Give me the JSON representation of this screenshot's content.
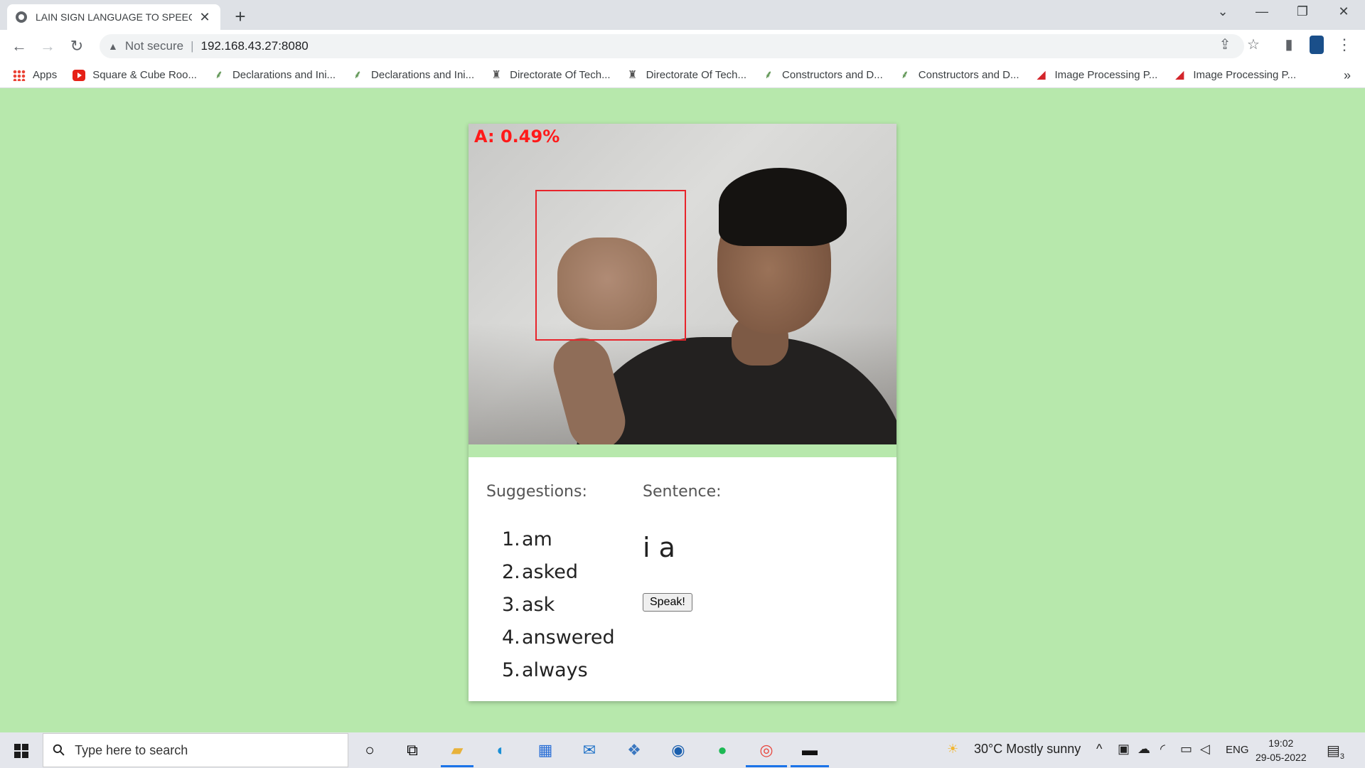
{
  "browser": {
    "tab_title": "LAIN SIGN LANGUAGE TO SPEEC",
    "tab_close": "✕",
    "new_tab": "+",
    "security_label": "Not secure",
    "separator": "|",
    "url": "192.168.43.27:8080"
  },
  "bookmarks": [
    {
      "label": "Apps",
      "icon": "apps-grid-icon"
    },
    {
      "label": "Square & Cube Roo...",
      "icon": "youtube-icon"
    },
    {
      "label": "Declarations and Ini...",
      "icon": "leaf-icon"
    },
    {
      "label": "Declarations and Ini...",
      "icon": "leaf-icon"
    },
    {
      "label": "Directorate Of Tech...",
      "icon": "emblem-icon"
    },
    {
      "label": "Directorate Of Tech...",
      "icon": "emblem-icon"
    },
    {
      "label": "Constructors and D...",
      "icon": "leaf-icon"
    },
    {
      "label": "Constructors and D...",
      "icon": "leaf-icon"
    },
    {
      "label": "Image Processing P...",
      "icon": "red-brush-icon"
    },
    {
      "label": "Image Processing P...",
      "icon": "red-brush-icon"
    }
  ],
  "bookmarks_overflow": "»",
  "app": {
    "prediction": "A:  0.49%",
    "suggestions_heading": "Suggestions:",
    "sentence_heading": "Sentence:",
    "suggestions": [
      {
        "num": "1.",
        "word": "am"
      },
      {
        "num": "2.",
        "word": "asked"
      },
      {
        "num": "3.",
        "word": "ask"
      },
      {
        "num": "4.",
        "word": "answered"
      },
      {
        "num": "5.",
        "word": "always"
      }
    ],
    "sentence": "i a",
    "speak_button": "Speak!"
  },
  "taskbar": {
    "search_placeholder": "Type here to search",
    "weather": "30°C  Mostly sunny",
    "language": "ENG",
    "time": "19:02",
    "date": "29-05-2022",
    "notification_count": "3"
  },
  "colors": {
    "page_bg": "#b7e8ac",
    "detection_box": "#e8242b",
    "prediction_text": "#ff1a1a"
  }
}
